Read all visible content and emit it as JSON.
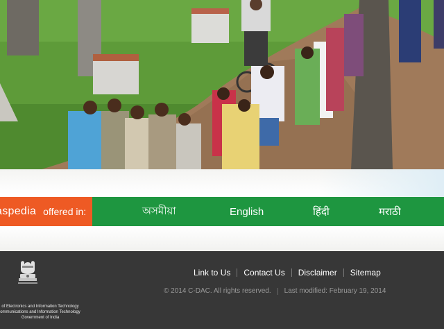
{
  "hero": {
    "image_description_icon": "village-children-walking-photo"
  },
  "language_bar": {
    "brand_fragment": "aspedia",
    "offered_in": "offered in:",
    "languages": [
      "অসমীয়া",
      "English",
      "हिंदी",
      "मराठी"
    ]
  },
  "footer": {
    "links": [
      "Link to Us",
      "Contact Us",
      "Disclaimer",
      "Sitemap"
    ],
    "copyright": "© 2014 C-DAC. All rights reserved.",
    "last_modified": "Last modified: February 19, 2014",
    "gov": {
      "line1": "of Electronics and Information Technology",
      "line2": "ommunications and Information Technology",
      "line3": "Government of India"
    },
    "emblem_caption": "सत्यमेव जयते"
  },
  "colors": {
    "brand_orange": "#ee5a24",
    "lang_green": "#1e9640",
    "footer_gray": "#373737"
  }
}
